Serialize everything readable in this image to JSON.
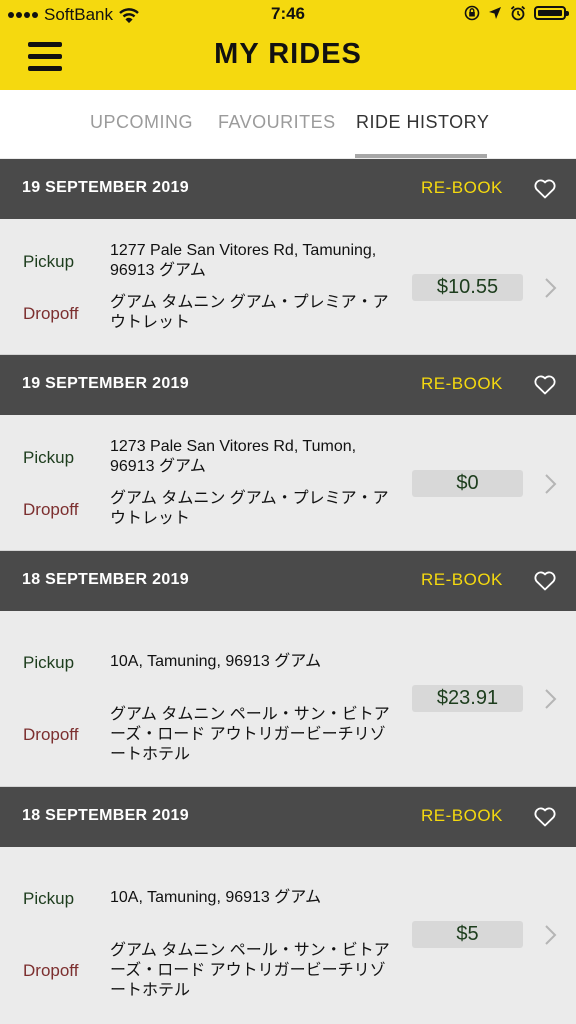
{
  "status_bar": {
    "carrier": "SoftBank",
    "time": "7:46"
  },
  "header": {
    "title": "MY RIDES"
  },
  "tabs": [
    {
      "label": "UPCOMING"
    },
    {
      "label": "FAVOURITES"
    },
    {
      "label": "RIDE HISTORY",
      "active": true
    }
  ],
  "rides": [
    {
      "date": "19 SEPTEMBER 2019",
      "rebook_label": "RE-BOOK",
      "pickup_label": "Pickup",
      "dropoff_label": "Dropoff",
      "pickup_address": "1277 Pale San Vitores Rd, Tamuning, 96913 グアム",
      "dropoff_address": "グアム タムニン グアム・プレミア・アウトレット",
      "price": "$10.55"
    },
    {
      "date": "19 SEPTEMBER 2019",
      "rebook_label": "RE-BOOK",
      "pickup_label": "Pickup",
      "dropoff_label": "Dropoff",
      "pickup_address": "1273 Pale San Vitores Rd, Tumon, 96913 グアム",
      "dropoff_address": "グアム タムニン グアム・プレミア・アウトレット",
      "price": "$0"
    },
    {
      "date": "18 SEPTEMBER 2019",
      "rebook_label": "RE-BOOK",
      "pickup_label": "Pickup",
      "dropoff_label": "Dropoff",
      "pickup_address": "10A, Tamuning, 96913 グアム",
      "dropoff_address": "グアム タムニン ペール・サン・ビトアーズ・ロード アウトリガービーチリゾートホテル",
      "price": "$23.91"
    },
    {
      "date": "18 SEPTEMBER 2019",
      "rebook_label": "RE-BOOK",
      "pickup_label": "Pickup",
      "dropoff_label": "Dropoff",
      "pickup_address": "10A, Tamuning, 96913 グアム",
      "dropoff_address": "グアム タムニン ペール・サン・ビトアーズ・ロード アウトリガービーチリゾートホテル",
      "price": "$5"
    }
  ],
  "colors": {
    "brand_yellow": "#f5d90f",
    "day_header": "#4a4a4a",
    "pickup_green": "#1d3d1d",
    "dropoff_red": "#7c2f2f"
  }
}
